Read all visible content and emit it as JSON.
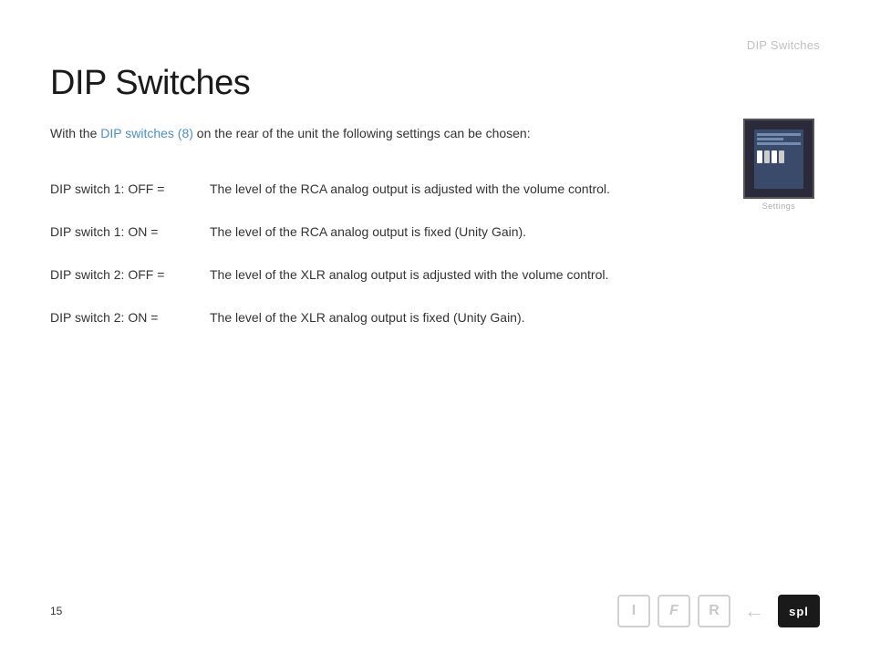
{
  "header": {
    "section_label": "DIP Switches"
  },
  "page": {
    "title": "DIP Switches",
    "intro_before_link": "With the ",
    "intro_link_text": "DIP switches (8)",
    "intro_after_link": " on the rear of the unit the following settings can be chosen:"
  },
  "settings_image": {
    "label": "Settings"
  },
  "switches": [
    {
      "label": "DIP switch 1: OFF =",
      "description": "The level of the RCA analog output is adjusted with the volume control."
    },
    {
      "label": "DIP switch 1: ON =",
      "description": "The level of the RCA analog output is fixed (Unity Gain)."
    },
    {
      "label": "DIP switch 2: OFF =",
      "description": "The level of the XLR analog output is adjusted with the volume control."
    },
    {
      "label": "DIP switch 2: ON =",
      "description": "The level of the XLR analog output is fixed (Unity Gain)."
    }
  ],
  "footer": {
    "page_number": "15",
    "icons": {
      "i_label": "I",
      "f_label": "F",
      "r_label": "R",
      "arrow_label": "←",
      "spl_label": "spl"
    }
  }
}
